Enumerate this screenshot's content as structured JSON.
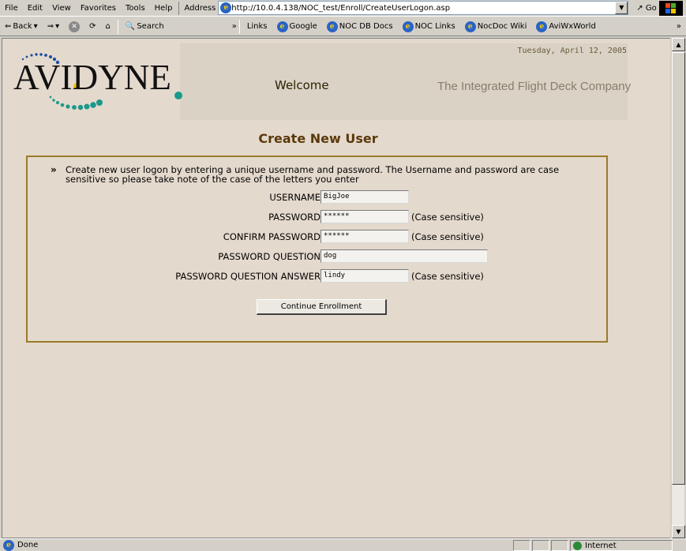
{
  "menubar": {
    "items": [
      "File",
      "Edit",
      "View",
      "Favorites",
      "Tools",
      "Help"
    ]
  },
  "address": {
    "label": "Address",
    "url": "http://10.0.4.138/NOC_test/Enroll/CreateUserLogon.asp",
    "go_label": "Go"
  },
  "toolbar": {
    "back_label": "Back",
    "search_label": "Search",
    "links_label": "Links",
    "links": [
      "Google",
      "NOC DB Docs",
      "NOC Links",
      "NocDoc Wiki",
      "AviWxWorld"
    ]
  },
  "header": {
    "brand": "AVIDYNE",
    "welcome": "Welcome",
    "date": "Tuesday, April 12, 2005",
    "tagline": "The Integrated Flight Deck Company"
  },
  "form": {
    "title": "Create New User",
    "intro": "Create new user logon by entering a unique username and password. The Username and password are case sensitive so please take note of the case of the letters you enter",
    "fields": [
      {
        "label": "USERNAME",
        "value": "BigJoe",
        "note": ""
      },
      {
        "label": "PASSWORD",
        "value": "******",
        "note": "(Case sensitive)"
      },
      {
        "label": "CONFIRM PASSWORD",
        "value": "******",
        "note": "(Case sensitive)"
      },
      {
        "label": "PASSWORD QUESTION",
        "value": "dog",
        "note": ""
      },
      {
        "label": "PASSWORD QUESTION ANSWER",
        "value": "lindy",
        "note": "(Case sensitive)"
      }
    ],
    "button": "Continue Enrollment"
  },
  "status": {
    "text": "Done",
    "zone": "Internet"
  },
  "colors": {
    "title": "#5a3a0a",
    "panel_border": "#9a7a2a",
    "logo_blue": "#1d4fa0",
    "logo_teal": "#1a9a8a",
    "logo_yellow": "#f2c500"
  }
}
